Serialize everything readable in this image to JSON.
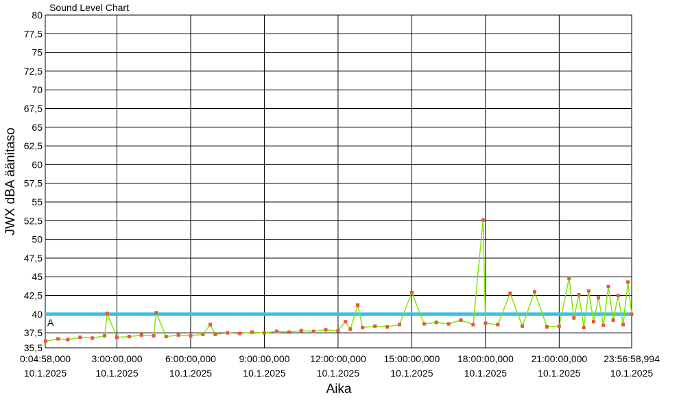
{
  "chart_data": {
    "type": "line",
    "title": "Sound Level Chart",
    "xlabel": "Aika",
    "ylabel": "JWX dBA äänitaso",
    "ylim": [
      35.5,
      80
    ],
    "xlim_hours": [
      0.0828,
      23.9497
    ],
    "y_ticks": [
      "80",
      "77,5",
      "75",
      "72,5",
      "70",
      "67,5",
      "65",
      "62,5",
      "60",
      "57,5",
      "55",
      "52,5",
      "50",
      "47,5",
      "45",
      "42,5",
      "40",
      "37,5",
      "35,5"
    ],
    "x_ticks": [
      {
        "time": "0:04:58,000",
        "date": "10.1.2025",
        "hour": 0.0828
      },
      {
        "time": "3:00:00,000",
        "date": "10.1.2025",
        "hour": 3
      },
      {
        "time": "6:00:00,000",
        "date": "10.1.2025",
        "hour": 6
      },
      {
        "time": "9:00:00,000",
        "date": "10.1.2025",
        "hour": 9
      },
      {
        "time": "12:00:00,000",
        "date": "10.1.2025",
        "hour": 12
      },
      {
        "time": "15:00:00,000",
        "date": "10.1.2025",
        "hour": 15
      },
      {
        "time": "18:00:00,000",
        "date": "10.1.2025",
        "hour": 18
      },
      {
        "time": "21:00:00,000",
        "date": "10.1.2025",
        "hour": 21
      },
      {
        "time": "23:56:58,994",
        "date": "10.1.2025",
        "hour": 23.9497
      }
    ],
    "threshold": {
      "label": "A",
      "value": 40,
      "color": "#3bbfe6"
    },
    "grid": true,
    "legend": "none",
    "series": [
      {
        "color": "#7fe600",
        "marker_color": "#e8573a",
        "x_hours": [
          0.1,
          0.6,
          1.0,
          1.5,
          2.0,
          2.5,
          2.6,
          3.0,
          3.5,
          4.0,
          4.5,
          4.6,
          5.0,
          5.5,
          6.0,
          6.5,
          6.8,
          7.0,
          7.5,
          8.0,
          8.5,
          9.0,
          9.5,
          10.0,
          10.5,
          11.0,
          11.5,
          12.0,
          12.3,
          12.5,
          12.8,
          13.0,
          13.5,
          14.0,
          14.5,
          15.0,
          15.5,
          16.0,
          16.5,
          17.0,
          17.5,
          17.9,
          18.0,
          18.5,
          19.0,
          19.5,
          20.0,
          20.5,
          21.0,
          21.4,
          21.6,
          21.8,
          22.0,
          22.2,
          22.4,
          22.6,
          22.8,
          23.0,
          23.2,
          23.4,
          23.6,
          23.8,
          23.95
        ],
        "values": [
          36.4,
          36.7,
          36.6,
          36.9,
          36.8,
          37.1,
          40.1,
          36.9,
          37.0,
          37.2,
          37.1,
          40.2,
          37.0,
          37.2,
          37.1,
          37.3,
          38.6,
          37.3,
          37.5,
          37.4,
          37.6,
          37.5,
          37.7,
          37.6,
          37.8,
          37.7,
          37.9,
          37.8,
          39.0,
          38.0,
          41.2,
          38.2,
          38.4,
          38.3,
          38.6,
          42.9,
          38.7,
          38.9,
          38.7,
          39.2,
          38.6,
          52.6,
          38.8,
          38.6,
          42.8,
          38.4,
          43.0,
          38.3,
          38.4,
          44.8,
          39.5,
          42.6,
          38.2,
          43.1,
          39.0,
          42.2,
          38.5,
          43.7,
          39.2,
          42.5,
          38.6,
          44.3,
          40.0
        ]
      }
    ]
  }
}
